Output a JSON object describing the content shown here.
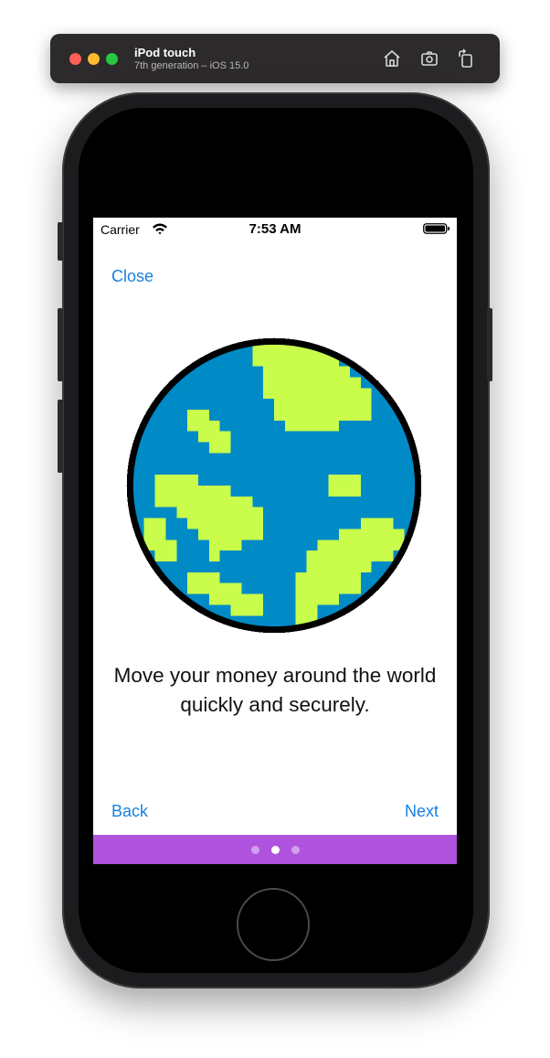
{
  "simulator": {
    "device_name": "iPod touch",
    "device_subtitle": "7th generation – iOS 15.0",
    "icons": [
      "home-icon",
      "screenshot-icon",
      "rotate-icon"
    ]
  },
  "status_bar": {
    "carrier": "Carrier",
    "time": "7:53 AM",
    "icons": [
      "wifi-icon",
      "battery-icon"
    ]
  },
  "nav": {
    "close_label": "Close",
    "back_label": "Back",
    "next_label": "Next"
  },
  "onboarding": {
    "illustration": "pixel-globe-icon",
    "caption": "Move your money around the world quickly and securely.",
    "page_count": 3,
    "current_page": 2
  },
  "colors": {
    "link": "#1a7fe0",
    "page_indicator_bar": "#af52de",
    "globe_ocean": "#008bc6",
    "globe_land": "#c9fc4b",
    "globe_outline": "#000000"
  }
}
